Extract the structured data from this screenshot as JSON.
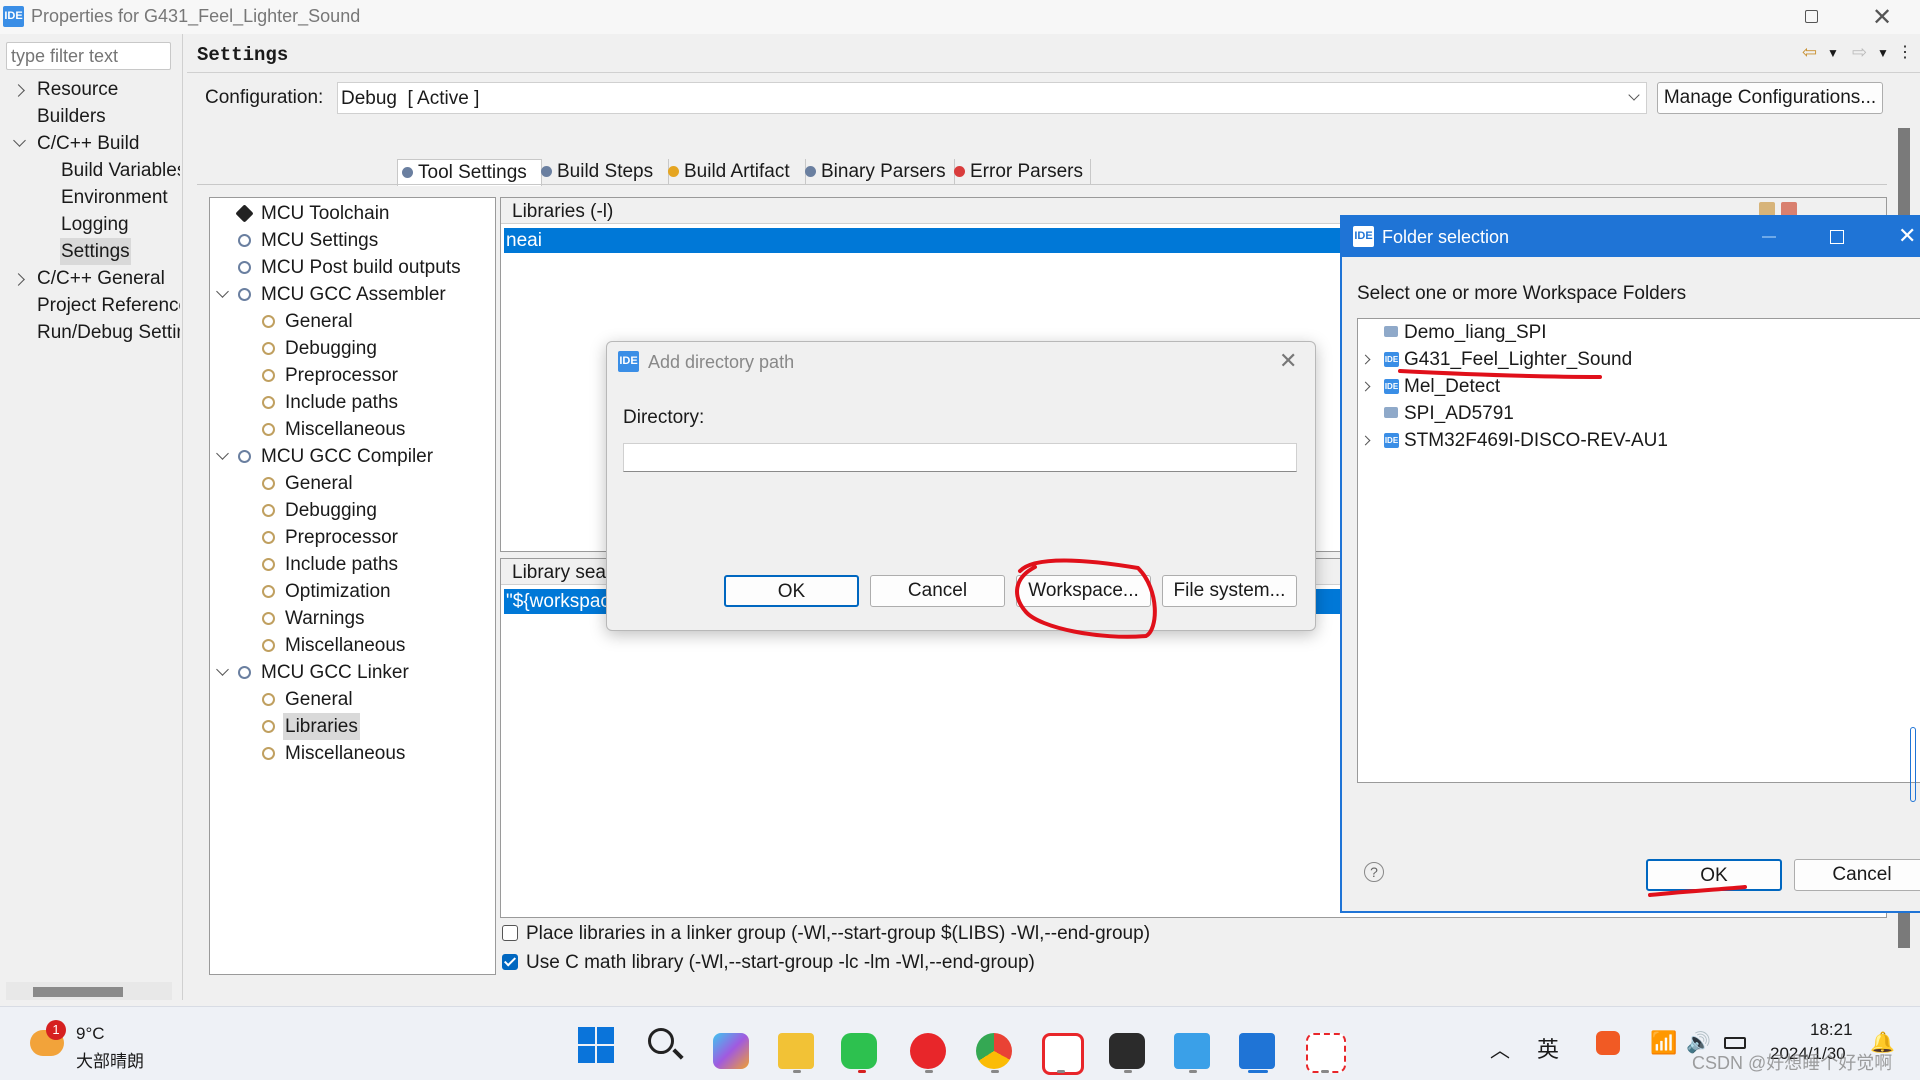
{
  "window": {
    "badge": "IDE",
    "title": "Properties for G431_Feel_Lighter_Sound"
  },
  "filter": {
    "placeholder": "type filter text"
  },
  "nav_tree": [
    {
      "label": "Resource",
      "indent": 0,
      "expander": "right"
    },
    {
      "label": "Builders",
      "indent": 0,
      "expander": ""
    },
    {
      "label": "C/C++ Build",
      "indent": 0,
      "expander": "down"
    },
    {
      "label": "Build Variables",
      "indent": 1,
      "expander": ""
    },
    {
      "label": "Environment",
      "indent": 1,
      "expander": ""
    },
    {
      "label": "Logging",
      "indent": 1,
      "expander": ""
    },
    {
      "label": "Settings",
      "indent": 1,
      "expander": "",
      "selected": true
    },
    {
      "label": "C/C++ General",
      "indent": 0,
      "expander": "right"
    },
    {
      "label": "Project References",
      "indent": 0,
      "expander": ""
    },
    {
      "label": "Run/Debug Settings",
      "indent": 0,
      "expander": ""
    }
  ],
  "settings_header": "Settings",
  "configuration": {
    "label": "Configuration:",
    "value": "Debug  [ Active ]",
    "manage_button": "Manage Configurations..."
  },
  "tabs": [
    "Tool Settings",
    "Build Steps",
    "Build Artifact",
    "Binary Parsers",
    "Error Parsers"
  ],
  "tool_tree": [
    {
      "label": "MCU Toolchain",
      "level": 0,
      "expander": ""
    },
    {
      "label": "MCU Settings",
      "level": 0,
      "expander": ""
    },
    {
      "label": "MCU Post build outputs",
      "level": 0,
      "expander": ""
    },
    {
      "label": "MCU GCC Assembler",
      "level": 0,
      "expander": "down"
    },
    {
      "label": "General",
      "level": 1
    },
    {
      "label": "Debugging",
      "level": 1
    },
    {
      "label": "Preprocessor",
      "level": 1
    },
    {
      "label": "Include paths",
      "level": 1
    },
    {
      "label": "Miscellaneous",
      "level": 1
    },
    {
      "label": "MCU GCC Compiler",
      "level": 0,
      "expander": "down"
    },
    {
      "label": "General",
      "level": 1
    },
    {
      "label": "Debugging",
      "level": 1
    },
    {
      "label": "Preprocessor",
      "level": 1
    },
    {
      "label": "Include paths",
      "level": 1
    },
    {
      "label": "Optimization",
      "level": 1
    },
    {
      "label": "Warnings",
      "level": 1
    },
    {
      "label": "Miscellaneous",
      "level": 1
    },
    {
      "label": "MCU GCC Linker",
      "level": 0,
      "expander": "down"
    },
    {
      "label": "General",
      "level": 1
    },
    {
      "label": "Libraries",
      "level": 1,
      "selected": true
    },
    {
      "label": "Miscellaneous",
      "level": 1
    }
  ],
  "libraries": {
    "header": "Libraries (-l)",
    "items": [
      "neai"
    ]
  },
  "library_search": {
    "header": "Library search path (-L)",
    "items": [
      "\"${workspace_loc:/${ProjName}/Core/Src}\""
    ]
  },
  "options": [
    {
      "label": "Place libraries in a linker group (-Wl,--start-group $(LIBS) -Wl,--end-group)",
      "checked": false
    },
    {
      "label": "Use C math library (-Wl,--start-group -lc -lm -Wl,--end-group)",
      "checked": true
    }
  ],
  "add_dir_dialog": {
    "badge": "IDE",
    "title": "Add directory path",
    "directory_label": "Directory:",
    "directory_value": "",
    "ok": "OK",
    "cancel": "Cancel",
    "workspace": "Workspace...",
    "filesystem": "File system..."
  },
  "folder_dialog": {
    "badge": "IDE",
    "title": "Folder selection",
    "prompt": "Select one or more Workspace Folders",
    "folders": [
      {
        "label": "Demo_liang_SPI",
        "expander": false,
        "type": "folder"
      },
      {
        "label": "G431_Feel_Lighter_Sound",
        "expander": true,
        "type": "ide"
      },
      {
        "label": "Mel_Detect",
        "expander": true,
        "type": "ide"
      },
      {
        "label": "SPI_AD5791",
        "expander": false,
        "type": "folder"
      },
      {
        "label": "STM32F469I-DISCO-REV-AU1",
        "expander": true,
        "type": "ide"
      }
    ],
    "help": "?",
    "ok": "OK",
    "cancel": "Cancel"
  },
  "taskbar": {
    "weather_badge": "1",
    "temperature": "9°C",
    "weather_desc": "大部晴朗",
    "ime": "英",
    "time": "18:21",
    "date": "2024/1/30",
    "watermark": "CSDN @好想睡个好觉啊"
  },
  "colors": {
    "selection": "#0078d7",
    "annotation": "#e0101a",
    "accent": "#0067c0"
  }
}
